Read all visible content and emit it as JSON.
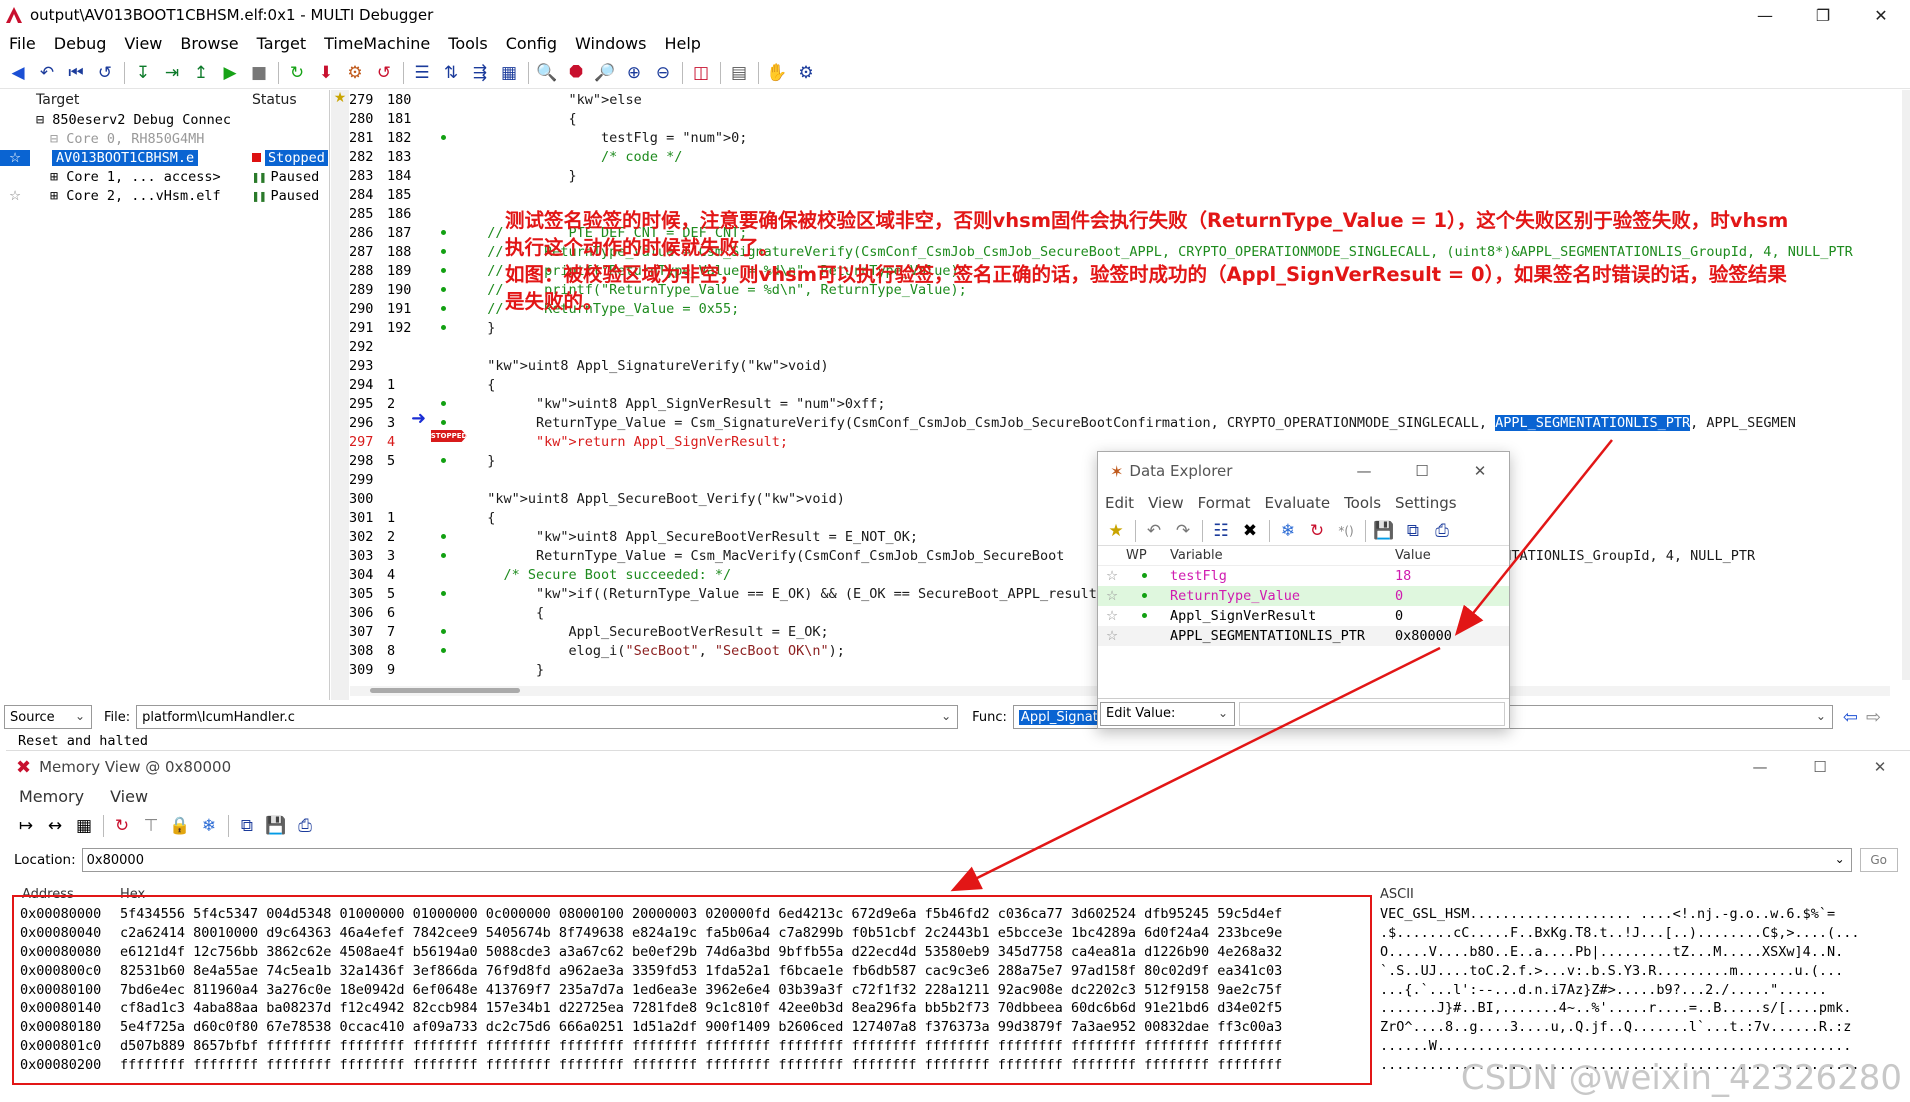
{
  "window": {
    "title": "output\\AV013BOOT1CBHSM.elf:0x1 - MULTI Debugger"
  },
  "menu": [
    "File",
    "Debug",
    "View",
    "Browse",
    "Target",
    "TimeMachine",
    "Tools",
    "Config",
    "Windows",
    "Help"
  ],
  "target_pane": {
    "col_target": "Target",
    "col_status": "Status",
    "rows": [
      {
        "text": "⊟ 850eserv2 Debug Connec",
        "status": ""
      },
      {
        "text": "⊟ Core 0, RH850G4MH",
        "status": ""
      },
      {
        "text": "AV013BOOT1CBHSM.e",
        "status": "Stopped"
      },
      {
        "text": "⊞ Core 1, ... access>",
        "status": "Paused"
      },
      {
        "text": "⊞ Core 2, ...vHsm.elf",
        "status": "Paused"
      }
    ]
  },
  "source": {
    "lines": [
      {
        "n1": "279",
        "n2": "180",
        "code": "            else"
      },
      {
        "n1": "280",
        "n2": "181",
        "code": "            {"
      },
      {
        "n1": "281",
        "n2": "182",
        "code": "                testFlg = 0;"
      },
      {
        "n1": "282",
        "n2": "183",
        "code": "                /* code */"
      },
      {
        "n1": "283",
        "n2": "184",
        "code": "            }"
      },
      {
        "n1": "284",
        "n2": "185",
        "code": ""
      },
      {
        "n1": "285",
        "n2": "186",
        "code": ""
      },
      {
        "n1": "286",
        "n2": "187",
        "code": "  //        PTE DEF CNT = DEF CNT;"
      },
      {
        "n1": "287",
        "n2": "188",
        "code": "  //     ReturnType_Value = Csm_SignatureVerify(CsmConf_CsmJob_CsmJob_SecureBoot_APPL, CRYPTO_OPERATIONMODE_SINGLECALL, (uint8*)&APPL_SEGMENTATIONLIS_GroupId, 4, NULL_PTR"
      },
      {
        "n1": "288",
        "n2": "189",
        "code": "  //     printf(\"ReturnType_Value = %d\\n\", ReturnType_Value);"
      },
      {
        "n1": "289",
        "n2": "190",
        "code": "  //     printf(\"ReturnType_Value = %d\\n\", ReturnType_Value);"
      },
      {
        "n1": "290",
        "n2": "191",
        "code": "  //     ReturnType_Value = 0x55;"
      },
      {
        "n1": "291",
        "n2": "192",
        "code": "  }"
      },
      {
        "n1": "292",
        "n2": "",
        "code": ""
      },
      {
        "n1": "293",
        "n2": "",
        "code": "  uint8 Appl_SignatureVerify(void)"
      },
      {
        "n1": "294",
        "n2": "1",
        "code": "  {"
      },
      {
        "n1": "295",
        "n2": "2",
        "code": "        uint8 Appl_SignVerResult = 0xff;"
      },
      {
        "n1": "296",
        "n2": "3",
        "code": "        ReturnType_Value = Csm_SignatureVerify(CsmConf_CsmJob_CsmJob_SecureBootConfirmation, CRYPTO_OPERATIONMODE_SINGLECALL, APPL_SEGMENTATIONLIS_PTR, APPL_SEGMEN"
      },
      {
        "n1": "297",
        "n2": "4",
        "code": "        return Appl_SignVerResult;"
      },
      {
        "n1": "298",
        "n2": "5",
        "code": "  }"
      },
      {
        "n1": "299",
        "n2": "",
        "code": ""
      },
      {
        "n1": "300",
        "n2": "",
        "code": "  uint8 Appl_SecureBoot_Verify(void)"
      },
      {
        "n1": "301",
        "n2": "1",
        "code": "  {"
      },
      {
        "n1": "302",
        "n2": "2",
        "code": "        uint8 Appl_SecureBootVerResult = E_NOT_OK;"
      },
      {
        "n1": "303",
        "n2": "3",
        "code": "        ReturnType_Value = Csm_MacVerify(CsmConf_CsmJob_CsmJob_SecureBoot                                         *)&APPL_SEGMENTATIONLIS_GroupId, 4, NULL_PTR"
      },
      {
        "n1": "304",
        "n2": "4",
        "code": "    /* Secure Boot succeeded: */"
      },
      {
        "n1": "305",
        "n2": "5",
        "code": "        if((ReturnType_Value == E_OK) && (E_OK == SecureBoot_APPL_result"
      },
      {
        "n1": "306",
        "n2": "6",
        "code": "        {"
      },
      {
        "n1": "307",
        "n2": "7",
        "code": "            Appl_SecureBootVerResult = E_OK;"
      },
      {
        "n1": "308",
        "n2": "8",
        "code": "            elog_i(\"SecBoot\", \"SecBoot OK\\n\");"
      },
      {
        "n1": "309",
        "n2": "9",
        "code": "        }"
      }
    ],
    "stopped_label": "STOPPED"
  },
  "annotation": {
    "line1": "测试签名验签的时候，注意要确保被校验区域非空，否则vhsm固件会执行失败（ReturnType_Value = 1），这个失败区别于验签失败，时vhsm",
    "line2": "执行这个动作的时候就失败了。",
    "line3": "如图：被校验区域为非空，则vhsm可以执行验签，签名正确的话，验签时成功的（Appl_SignVerResult = 0），如果签名时错误的话，验签结果",
    "line4": "是失败的。"
  },
  "controls": {
    "source_combo": "Source",
    "file_label": "File:",
    "file_value": "platform\\IcumHandler.c",
    "func_label": "Func:",
    "func_value": "Appl_Signat",
    "status": "Reset and halted"
  },
  "data_explorer": {
    "title": "Data Explorer",
    "menu": [
      "Edit",
      "View",
      "Format",
      "Evaluate",
      "Tools",
      "Settings"
    ],
    "col_wp": "WP",
    "col_var": "Variable",
    "col_val": "Value",
    "rows": [
      {
        "var": "testFlg",
        "val": "18"
      },
      {
        "var": "ReturnType_Value",
        "val": "0"
      },
      {
        "var": "Appl_SignVerResult",
        "val": "0"
      },
      {
        "var": "APPL_SEGMENTATIONLIS_PTR",
        "val": "0x80000"
      }
    ],
    "edit_value": "Edit Value:"
  },
  "memory": {
    "title": "Memory View @ 0x80000",
    "menu": [
      "Memory",
      "View"
    ],
    "location_label": "Location:",
    "location": "0x80000",
    "go": "Go",
    "col_address": "Address",
    "col_hex": "Hex",
    "col_ascii": "ASCII",
    "rows": [
      {
        "addr": "0x00080000",
        "hex": "5f434556 5f4c5347 004d5348 01000000 01000000 0c000000 08000100 20000003 020000fd 6ed4213c 672d9e6a f5b46fd2 c036ca77 3d602524 dfb95245 59c5d4ef",
        "ascii": "VEC_GSL_HSM.................... ....<!.nj.-g.o..w.6.$%`="
      },
      {
        "addr": "0x00080040",
        "hex": "c2a62414 80010000 d9c64363 46a4efef 7842cee9 5405674b 8f749638 e824a19c fa5b06a4 c7a8299b f0b51cbf 2c2443b1 e5bcce3e 1bc4289a 6d0f24a4 233bce9e",
        "ascii": ".$.......cC.....F..BxKg.T8.t..!J...[..)........C$,>....(..."
      },
      {
        "addr": "0x00080080",
        "hex": "e6121d4f 12c756bb 3862c62e 4508ae4f b56194a0 5088cde3 a3a67c62 be0ef29b 74d6a3bd 9bffb55a d22ecd4d 53580eb9 345d7758 ca4ea81a d1226b90 4e268a32",
        "ascii": "O.....V....b8O..E..a....Pb|.........tZ...M.....XSXw]4..N."
      },
      {
        "addr": "0x000800c0",
        "hex": "82531b60 8e4a55ae 74c5ea1b 32a1436f 3ef866da 76f9d8fd a962ae3a 3359fd53 1fda52a1 f6bcae1e fb6db587 cac9c3e6 288a75e7 97ad158f 80c02d9f ea341c03",
        "ascii": "`.S..UJ....toC.2.f.>...v:.b.S.Y3.R.........m.......u.(..."
      },
      {
        "addr": "0x00080100",
        "hex": "7bd6e4ec 811960a4 3a276c0e 18e0942d 6ef0648e 413769f7 235a7d7a 1ed6ea3e 3962e6e4 03b39a3f c72f1f32 228a1211 92ac908e dc2202c3 512f9158 9ae2c75f",
        "ascii": "...{.`...l':--...d.n.i7Az}Z#>.....b9?...2./.....\"......"
      },
      {
        "addr": "0x00080140",
        "hex": "cf8ad1c3 4aba88aa ba08237d f12c4942 82ccb984 157e34b1 d22725ea 7281fde8 9c1c810f 42ee0b3d 8ea296fa bb5b2f73 70dbbeea 60dc6b6d 91e21bd6 d34e02f5",
        "ascii": ".......J}#..BI,.......4~..%'.....r....=..B.....s/[....pmk."
      },
      {
        "addr": "0x00080180",
        "hex": "5e4f725a d60c0f80 67e78538 0ccac410 af09a733 dc2c75d6 666a0251 1d51a2df 900f1409 b2606ced 127407a8 f376373a 99d3879f 7a3ae952 00832dae ff3c00a3",
        "ascii": "ZrO^....8..g....3....u,.Q.jf..Q.......l`...t.:7v......R.:z"
      },
      {
        "addr": "0x000801c0",
        "hex": "d507b889 8657bfbf ffffffff ffffffff ffffffff ffffffff ffffffff ffffffff ffffffff ffffffff ffffffff ffffffff ffffffff ffffffff ffffffff ffffffff",
        "ascii": "......W..................................................."
      },
      {
        "addr": "0x00080200",
        "hex": "ffffffff ffffffff ffffffff ffffffff ffffffff ffffffff ffffffff ffffffff ffffffff ffffffff ffffffff ffffffff ffffffff ffffffff ffffffff ffffffff",
        "ascii": "..........................................................."
      }
    ]
  },
  "watermark": "CSDN @weixin_42326280",
  "colors": {
    "highlight": "#0a64d2",
    "annotation": "#e21616",
    "breakpoint_dot": "#12a012",
    "keyword": "#1b3bd4",
    "comment": "#1e8b1e"
  }
}
